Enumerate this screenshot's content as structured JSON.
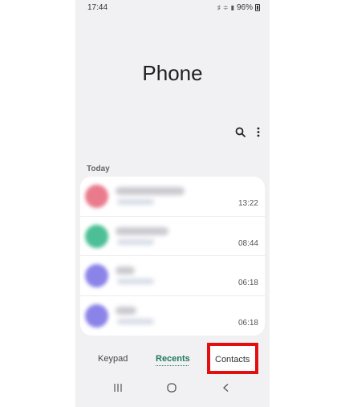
{
  "status_bar": {
    "time": "17:44",
    "battery_percent": "96%"
  },
  "header": {
    "title": "Phone"
  },
  "recents": {
    "section_label": "Today",
    "calls": [
      {
        "avatar_color": "#e97b8d",
        "time": "13:22"
      },
      {
        "avatar_color": "#4cbf97",
        "time": "08:44"
      },
      {
        "avatar_color": "#8b83e8",
        "time": "06:18"
      },
      {
        "avatar_color": "#8b83e8",
        "time": "06:18"
      }
    ]
  },
  "tabs": {
    "keypad": "Keypad",
    "recents": "Recents",
    "contacts": "Contacts",
    "active": "Recents",
    "highlight_color": "#e10f0f",
    "accent_color": "#1f7a5c"
  },
  "icons": {
    "search": "search-icon",
    "more": "more-vertical-icon",
    "nav_recent": "recent-apps-icon",
    "nav_home": "home-icon",
    "nav_back": "back-icon"
  }
}
